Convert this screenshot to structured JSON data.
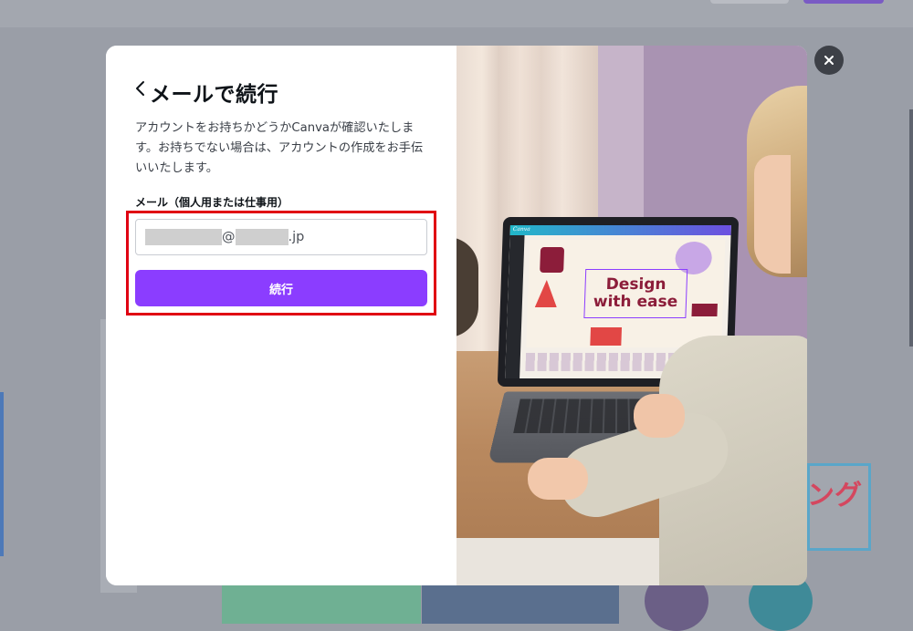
{
  "modal": {
    "title": "メールで続行",
    "description": "アカウントをお持ちかどうかCanvaが確認いたします。お持ちでない場合は、アカウントの作成をお手伝いいたします。",
    "email_label": "メール（個人用または仕事用）",
    "email_value_at": "@",
    "email_value_suffix": ".jp",
    "continue_label": "続行",
    "back_icon": "chevron-left-icon",
    "close_icon": "close-icon",
    "highlight_color": "#e00012",
    "accent_color": "#8b3dff"
  },
  "photo": {
    "screen_brand": "Canva",
    "screen_headline_line1": "Design",
    "screen_headline_line2": "with ease"
  },
  "background": {
    "promo_text": "ング"
  }
}
